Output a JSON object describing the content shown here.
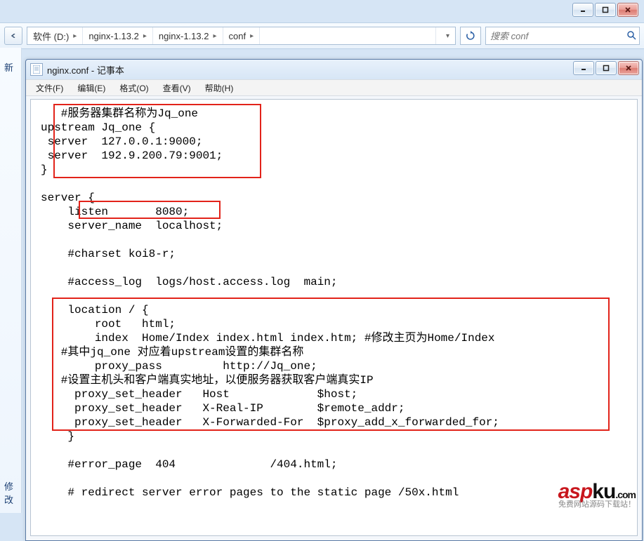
{
  "parent_window": {
    "controls": {
      "min": "min",
      "max": "max",
      "close": "close"
    }
  },
  "path_bar": {
    "crumbs": [
      {
        "label": "软件 (D:)",
        "has_arrow": true
      },
      {
        "label": "nginx-1.13.2",
        "has_arrow": true
      },
      {
        "label": "nginx-1.13.2",
        "has_arrow": true
      },
      {
        "label": "conf",
        "has_arrow": true
      }
    ],
    "search_placeholder": "搜索 conf"
  },
  "left_stub": {
    "top_label": "新",
    "bottom_label": "修改"
  },
  "notepad": {
    "title": "nginx.conf - 记事本",
    "menus": [
      "文件(F)",
      "编辑(E)",
      "格式(O)",
      "查看(V)",
      "帮助(H)"
    ],
    "content": "   #服务器集群名称为Jq_one\nupstream Jq_one {\n server  127.0.0.1:9000;\n server  192.9.200.79:9001;\n}\n\nserver {\n    listen       8080;\n    server_name  localhost;\n\n    #charset koi8-r;\n\n    #access_log  logs/host.access.log  main;\n\n    location / {\n        root   html;\n        index  Home/Index index.html index.htm; #修改主页为Home/Index\n   #其中jq_one 对应着upstream设置的集群名称\n        proxy_pass         http://Jq_one;\n   #设置主机头和客户端真实地址，以便服务器获取客户端真实IP\n     proxy_set_header   Host             $host;\n     proxy_set_header   X-Real-IP        $remote_addr;\n     proxy_set_header   X-Forwarded-For  $proxy_add_x_forwarded_for;\n    }\n\n    #error_page  404              /404.html;\n\n    # redirect server error pages to the static page /50x.html\n"
  },
  "logo": {
    "line1_asp": "asp",
    "line1_ku": "ku",
    "line1_com": ".com",
    "line2": "免费网站源码下载站！"
  }
}
